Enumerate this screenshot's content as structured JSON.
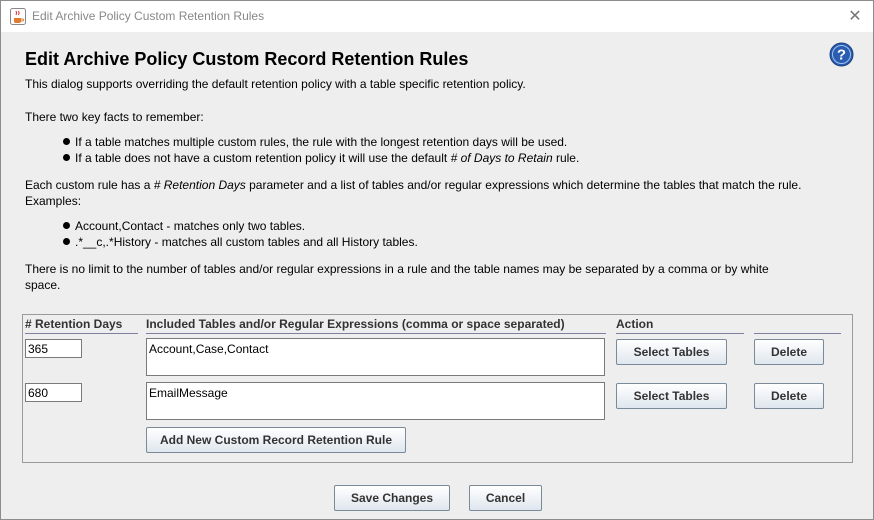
{
  "window": {
    "title": "Edit Archive Policy Custom Retention Rules",
    "close_glyph": "✕"
  },
  "dialog": {
    "heading": "Edit Archive Policy Custom Record Retention Rules",
    "intro": "This dialog supports overriding the default retention policy with a table specific retention policy.",
    "facts_heading": "There two key facts to remember:",
    "fact1": "If a table matches multiple custom rules, the rule with the longest retention days will be used.",
    "fact2_prefix": "If a table does not have a custom retention policy it will use the default ",
    "fact2_em": "# of Days to Retain",
    "fact2_suffix": " rule.",
    "rule_desc_prefix": "Each custom rule has a ",
    "rule_desc_em": "# Retention Days",
    "rule_desc_suffix": " parameter and a list of tables and/or regular expressions which determine the tables that match the rule.",
    "examples_label": "Examples:",
    "example1": "Account,Contact - matches only two tables.",
    "example2": ".*__c,.*History - matches all custom tables and all History tables.",
    "limit_line1": "There is no limit to the number of tables and/or regular expressions in a rule and the table names may be separated by a comma or by white",
    "limit_line2": "space."
  },
  "rules_table": {
    "headers": {
      "days": "# Retention Days",
      "tables": "Included Tables and/or Regular Expressions (comma or space separated)",
      "action": "Action"
    },
    "rows": [
      {
        "days": "365",
        "tables": "Account,Case,Contact",
        "select_label": "Select Tables",
        "delete_label": "Delete"
      },
      {
        "days": "680",
        "tables": "EmailMessage",
        "select_label": "Select Tables",
        "delete_label": "Delete"
      }
    ],
    "add_rule_label": "Add New Custom Record Retention Rule"
  },
  "footer": {
    "save_label": "Save Changes",
    "cancel_label": "Cancel"
  },
  "icons": {
    "app": "java-coffee-cup-icon",
    "help": "help-question-icon",
    "close": "close-icon"
  },
  "colors": {
    "help_blue": "#2a5db0",
    "button_border": "#7a8a99"
  }
}
